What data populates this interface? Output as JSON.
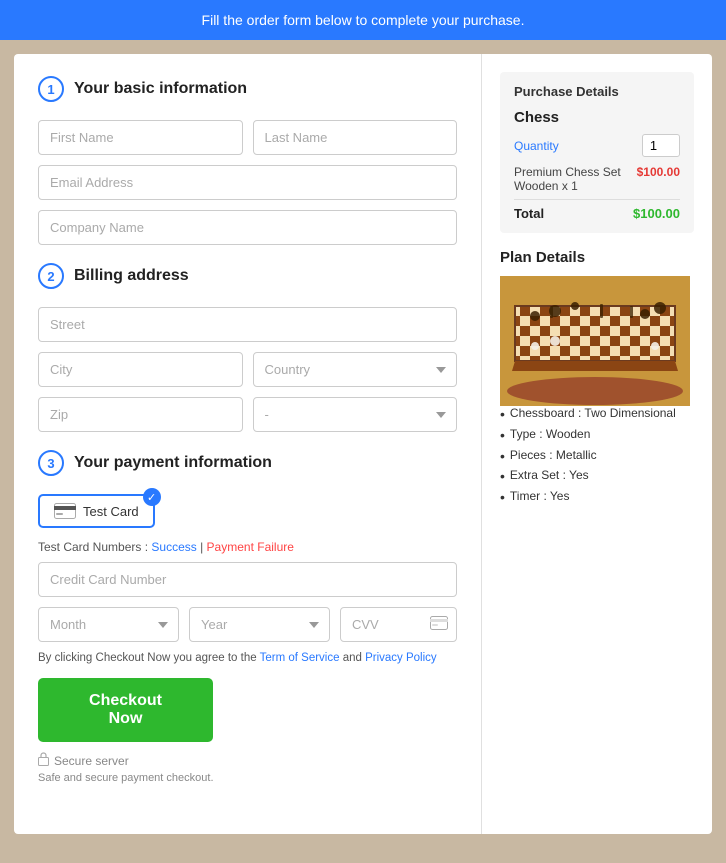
{
  "banner": {
    "text": "Fill the order form below to complete your purchase."
  },
  "sections": {
    "basic_info": {
      "number": "1",
      "title": "Your basic information"
    },
    "billing": {
      "number": "2",
      "title": "Billing address"
    },
    "payment": {
      "number": "3",
      "title": "Your payment information"
    }
  },
  "form": {
    "first_name_placeholder": "First Name",
    "last_name_placeholder": "Last Name",
    "email_placeholder": "Email Address",
    "company_placeholder": "Company Name",
    "street_placeholder": "Street",
    "city_placeholder": "City",
    "country_placeholder": "Country",
    "zip_placeholder": "Zip",
    "state_placeholder": "-",
    "card_label": "Test Card",
    "credit_card_placeholder": "Credit Card Number",
    "month_placeholder": "Month",
    "year_placeholder": "Year",
    "cvv_placeholder": "CVV"
  },
  "test_card": {
    "label": "Test Card Numbers :",
    "success": "Success",
    "pipe": " | ",
    "failure": "Payment Failure"
  },
  "terms": {
    "prefix": "By clicking Checkout Now you agree to the ",
    "tos": "Term of Service",
    "and": " and ",
    "privacy": "Privacy Policy"
  },
  "checkout_button": "Checkout Now",
  "secure": {
    "server": "Secure server",
    "sub": "Safe and secure payment checkout."
  },
  "purchase_details": {
    "title": "Purchase Details",
    "product_name": "Chess",
    "quantity_label": "Quantity",
    "quantity_value": "1",
    "product_desc": "Premium Chess Set\nWooden x 1",
    "product_price": "$100.00",
    "total_label": "Total",
    "total_price": "$100.00"
  },
  "plan_details": {
    "title": "Plan Details",
    "features": [
      "Chessboard : Two Dimensional",
      "Type : Wooden",
      "Pieces : Metallic",
      "Extra Set : Yes",
      "Timer : Yes"
    ]
  }
}
